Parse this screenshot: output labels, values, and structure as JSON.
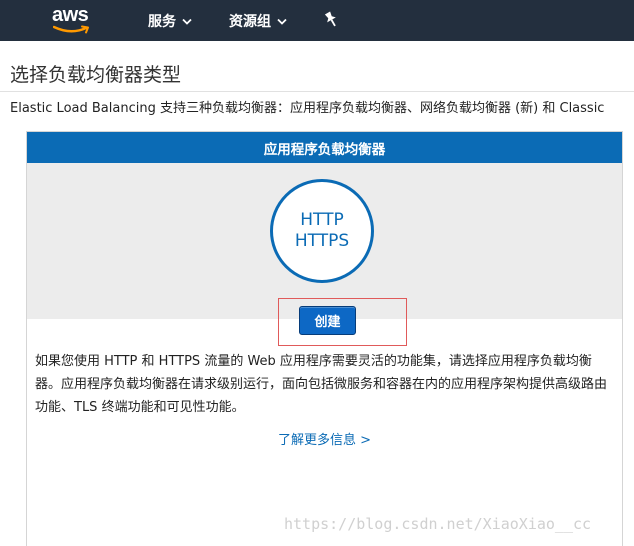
{
  "topbar": {
    "logo_text": "aws",
    "nav": [
      {
        "label": "服务"
      },
      {
        "label": "资源组"
      }
    ],
    "chevron": "⌄"
  },
  "page": {
    "title": "选择负载均衡器类型",
    "intro": "Elastic Load Balancing 支持三种负载均衡器：应用程序负载均衡器、网络负载均衡器 (新) 和 Classic"
  },
  "card": {
    "header": "应用程序负载均衡器",
    "protocols": [
      "HTTP",
      "HTTPS"
    ],
    "create_label": "创建",
    "description": "如果您使用 HTTP 和 HTTPS 流量的 Web 应用程序需要灵活的功能集，请选择应用程序负载均衡器。应用程序负载均衡器在请求级别运行，面向包括微服务和容器在内的应用程序架构提供高级路由功能、TLS 终端功能和可见性功能。",
    "learn_more": "了解更多信息 >"
  },
  "watermark": "https://blog.csdn.net/XiaoXiao__cc",
  "colors": {
    "topbar": "#232f3e",
    "header_blue": "#0b6bb5",
    "button_blue": "#0d68c5",
    "highlight_red": "#e05a5a",
    "aws_orange": "#ff9900"
  }
}
